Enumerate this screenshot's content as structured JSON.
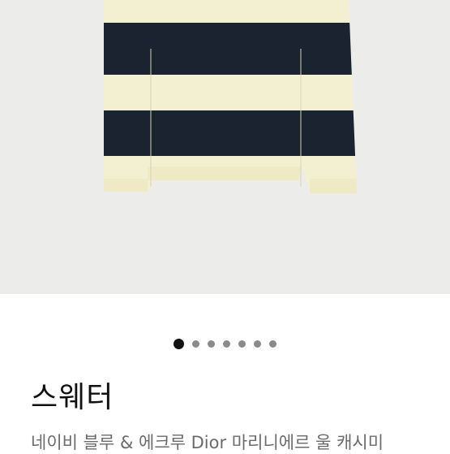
{
  "product": {
    "title": "스웨터",
    "subtitle": "네이비 블루 & 에크루 Dior 마리니에르 울 캐시미"
  },
  "gallery": {
    "image_icon": "striped-sweater-image",
    "colors": {
      "background": "#ececeb",
      "cream": "#f3efd1",
      "navy": "#1b2230"
    },
    "pager": {
      "count": 7,
      "active_index": 0
    }
  }
}
